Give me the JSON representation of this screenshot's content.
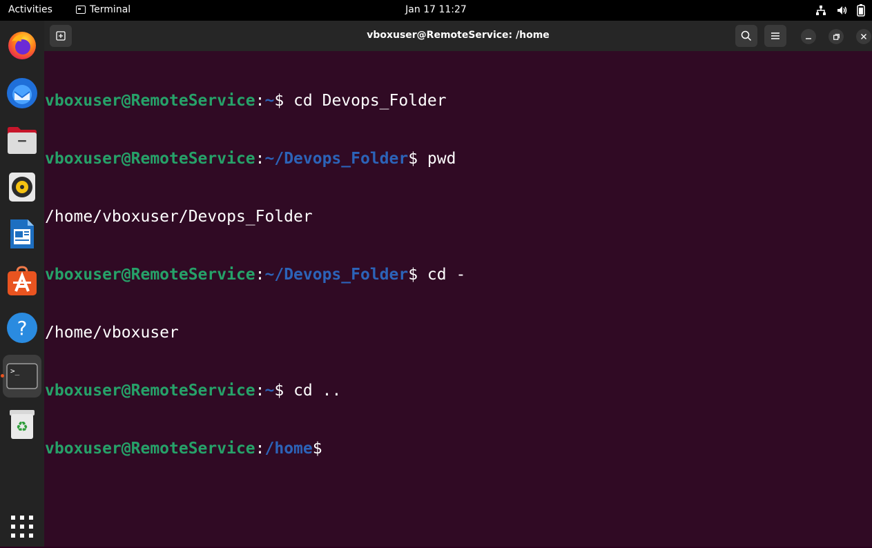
{
  "topbar": {
    "activities": "Activities",
    "app_name": "Terminal",
    "clock": "Jan 17  11:27"
  },
  "window": {
    "title": "vboxuser@RemoteService: /home"
  },
  "terminal": {
    "lines": [
      {
        "user": "vboxuser@RemoteService",
        "sep": ":",
        "path": "~",
        "prompt": "$ ",
        "cmd": "cd Devops_Folder"
      },
      {
        "user": "vboxuser@RemoteService",
        "sep": ":",
        "path": "~/Devops_Folder",
        "prompt": "$ ",
        "cmd": "pwd"
      },
      {
        "output": "/home/vboxuser/Devops_Folder"
      },
      {
        "user": "vboxuser@RemoteService",
        "sep": ":",
        "path": "~/Devops_Folder",
        "prompt": "$ ",
        "cmd": "cd -"
      },
      {
        "output": "/home/vboxuser"
      },
      {
        "user": "vboxuser@RemoteService",
        "sep": ":",
        "path": "~",
        "prompt": "$ ",
        "cmd": "cd .."
      },
      {
        "user": "vboxuser@RemoteService",
        "sep": ":",
        "path": "/home",
        "prompt": "$",
        "cmd": ""
      }
    ]
  },
  "dock": {
    "items": [
      "firefox-icon",
      "thunderbird-icon",
      "files-icon",
      "rhythmbox-icon",
      "writer-icon",
      "app-center-icon",
      "help-icon",
      "terminal-icon",
      "trash-icon",
      "show-apps-icon"
    ]
  },
  "colors": {
    "terminal_bg": "#300a24",
    "prompt_user": "#26a269",
    "prompt_path": "#2c63b8",
    "accent": "#e95420"
  }
}
